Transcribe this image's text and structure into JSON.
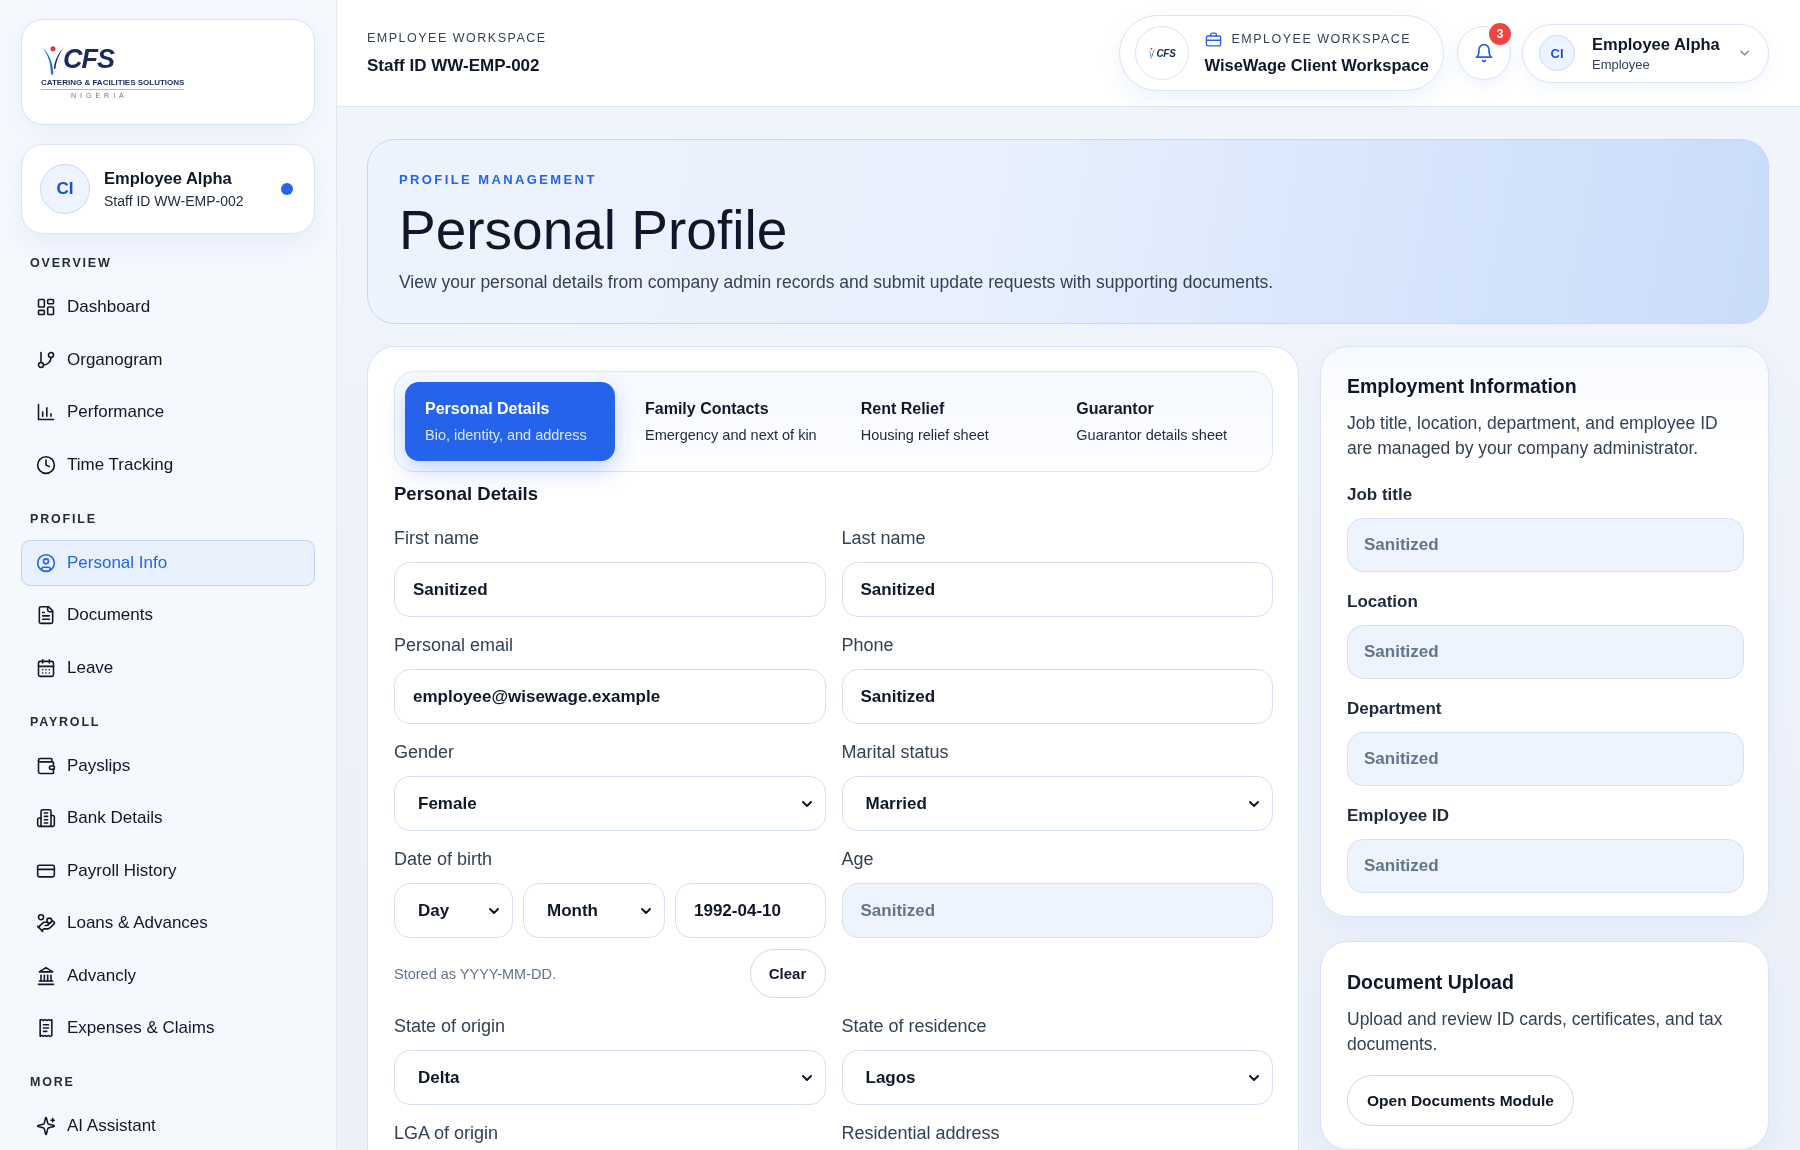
{
  "sidebar": {
    "logo": {
      "wordmark": "CFS",
      "tagline": "CATERING & FACILITIES SOLUTIONS",
      "region": "NIGERIA"
    },
    "profile": {
      "initials": "CI",
      "name": "Employee Alpha",
      "staff_id": "Staff ID WW-EMP-002",
      "online": true
    },
    "sections": [
      {
        "title": "OVERVIEW",
        "items": [
          {
            "label": "Dashboard",
            "selected": false
          },
          {
            "label": "Organogram",
            "selected": false
          },
          {
            "label": "Performance",
            "selected": false
          },
          {
            "label": "Time Tracking",
            "selected": false
          }
        ]
      },
      {
        "title": "PROFILE",
        "items": [
          {
            "label": "Personal Info",
            "selected": true
          },
          {
            "label": "Documents",
            "selected": false
          },
          {
            "label": "Leave",
            "selected": false
          }
        ]
      },
      {
        "title": "PAYROLL",
        "items": [
          {
            "label": "Payslips",
            "selected": false
          },
          {
            "label": "Bank Details",
            "selected": false
          },
          {
            "label": "Payroll History",
            "selected": false
          },
          {
            "label": "Loans & Advances",
            "selected": false
          },
          {
            "label": "Advancly",
            "selected": false
          },
          {
            "label": "Expenses & Claims",
            "selected": false
          }
        ]
      },
      {
        "title": "MORE",
        "items": [
          {
            "label": "AI Assistant",
            "selected": false
          }
        ]
      }
    ]
  },
  "header": {
    "eyebrow": "EMPLOYEE WORKSPACE",
    "staff_id": "Staff ID WW-EMP-002",
    "workspace": {
      "logo_wordmark": "CFS",
      "eyebrow": "EMPLOYEE WORKSPACE",
      "name": "WiseWage Client Workspace"
    },
    "notifications": {
      "count": "3"
    },
    "user": {
      "initials": "CI",
      "name": "Employee Alpha",
      "role": "Employee"
    }
  },
  "hero": {
    "eyebrow": "PROFILE MANAGEMENT",
    "title": "Personal Profile",
    "description": "View your personal details from company admin records and submit update requests with supporting documents."
  },
  "profile_form": {
    "tabs": [
      {
        "title": "Personal Details",
        "subtitle": "Bio, identity, and address",
        "selected": true
      },
      {
        "title": "Family Contacts",
        "subtitle": "Emergency and next of kin",
        "selected": false
      },
      {
        "title": "Rent Relief",
        "subtitle": "Housing relief sheet",
        "selected": false
      },
      {
        "title": "Guarantor",
        "subtitle": "Guarantor details sheet",
        "selected": false
      }
    ],
    "section_title": "Personal Details",
    "fields": [
      {
        "kind": "text",
        "label": "First name",
        "value": "Sanitized"
      },
      {
        "kind": "text",
        "label": "Last name",
        "value": "Sanitized"
      },
      {
        "kind": "text",
        "label": "Personal email",
        "value": "employee@wisewage.example"
      },
      {
        "kind": "text",
        "label": "Phone",
        "value": "Sanitized"
      },
      {
        "kind": "select",
        "label": "Gender",
        "value": "Female"
      },
      {
        "kind": "select",
        "label": "Marital status",
        "value": "Married"
      },
      {
        "kind": "date",
        "label": "Date of birth",
        "day": "Day",
        "month": "Month",
        "value": "1992-04-10",
        "hint": "Stored as YYYY-MM-DD.",
        "action": "Clear"
      },
      {
        "kind": "readonly",
        "label": "Age",
        "value": "Sanitized"
      },
      {
        "kind": "select",
        "label": "State of origin",
        "value": "Delta"
      },
      {
        "kind": "select",
        "label": "State of residence",
        "value": "Lagos"
      },
      {
        "kind": "label_only",
        "label": "LGA of origin"
      },
      {
        "kind": "label_only",
        "label": "Residential address"
      }
    ]
  },
  "employment_card": {
    "title": "Employment Information",
    "description": "Job title, location, department, and employee ID are managed by your company administrator.",
    "fields": [
      {
        "label": "Job title",
        "value": "Sanitized"
      },
      {
        "label": "Location",
        "value": "Sanitized"
      },
      {
        "label": "Department",
        "value": "Sanitized"
      },
      {
        "label": "Employee ID",
        "value": "Sanitized"
      }
    ]
  },
  "document_card": {
    "title": "Document Upload",
    "description": "Upload and review ID cards, certificates, and tax documents.",
    "button": "Open Documents Module"
  }
}
